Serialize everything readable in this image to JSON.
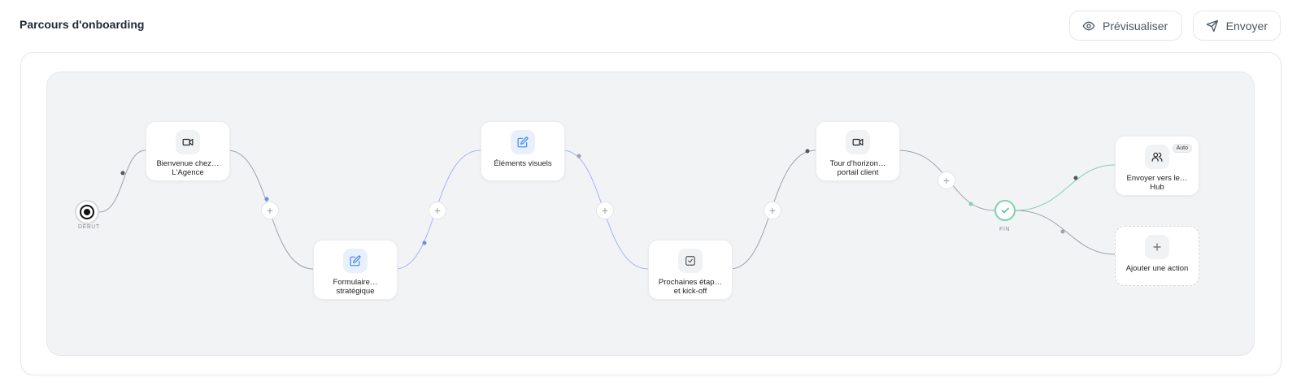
{
  "header": {
    "title": "Parcours d'onboarding",
    "preview_label": "Prévisualiser",
    "send_label": "Envoyer"
  },
  "flow": {
    "start_label": "DÉBUT",
    "end_label": "FIN",
    "nodes": [
      {
        "label": "Bienvenue chez…\nL'Agence",
        "icon": "video-icon"
      },
      {
        "label": "Formulaire…\nstratégique",
        "icon": "edit-icon"
      },
      {
        "label": "Éléments visuels",
        "icon": "edit-icon"
      },
      {
        "label": "Prochaines étap…\net kick-off",
        "icon": "checkbox-icon"
      },
      {
        "label": "Tour d'horizon…\nportail client",
        "icon": "video-icon"
      }
    ],
    "actions": [
      {
        "label": "Envoyer vers le…\nHub",
        "icon": "users-icon",
        "badge": "Auto"
      },
      {
        "label": "Ajouter une action",
        "icon": "plus-icon"
      }
    ],
    "add_step_symbol": "+"
  },
  "colors": {
    "accent_blue": "#3b82f6",
    "success_green": "#34c38f",
    "edge_gray": "#9ca3af"
  }
}
